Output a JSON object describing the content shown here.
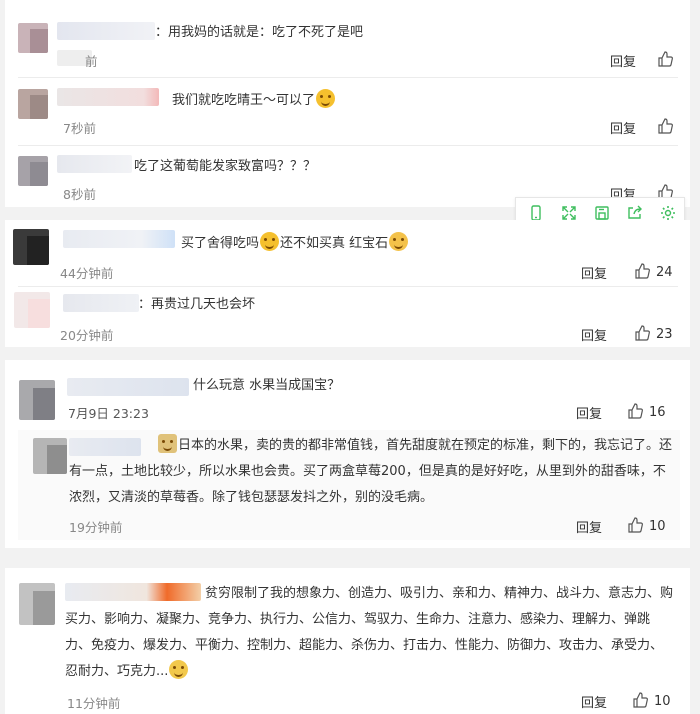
{
  "colors": {
    "accent": "#3fbe5e",
    "text": "#333333",
    "muted": "#888888"
  },
  "reply_label": "回复",
  "comments": [
    {
      "id": "c1",
      "text": "用我妈的话就是：吃了不死了是吧",
      "time": "前",
      "like": ""
    },
    {
      "id": "c2",
      "text": "我们就吃吃晴王～可以了",
      "time": "7秒前",
      "like": ""
    },
    {
      "id": "c3",
      "text": "吃了这葡萄能发家致富吗？？？",
      "time": "8秒前",
      "like": ""
    },
    {
      "id": "c4",
      "text_a": "买了舍得吃吗",
      "text_b": "还不如买真 红宝石",
      "time": "44分钟前",
      "like": "24"
    },
    {
      "id": "c5",
      "text": "再贵过几天也会坏",
      "time": "20分钟前",
      "like": "23"
    },
    {
      "id": "c6",
      "text": "什么玩意 水果当成国宝？",
      "time": "7月9日 23:23",
      "like": "16"
    },
    {
      "id": "c7",
      "text": "日本的水果，卖的贵的都非常值钱，首先甜度就在预定的标准，剩下的，我忘记了。还有一点，土地比较少，所以水果也会贵。买了两盒草莓200，但是真的是好好吃，从里到外的甜香味，不浓烈，又清淡的草莓香。除了钱包瑟瑟发抖之外，别的没毛病。",
      "time": "19分钟前",
      "like": "10"
    },
    {
      "id": "c8",
      "text": "贫穷限制了我的想象力、创造力、吸引力、亲和力、精神力、战斗力、意志力、购买力、影响力、凝聚力、竞争力、执行力、公信力、驾驭力、生命力、注意力、感染力、理解力、弹跳力、免疫力、爆发力、平衡力、控制力、超能力、杀伤力、打击力、性能力、防御力、攻击力、承受力、忍耐力、巧克力...",
      "time": "11分钟前",
      "like": "10"
    }
  ],
  "toolbar": {
    "icons": [
      "phone-icon",
      "expand-icon",
      "save-icon",
      "share-icon",
      "settings-icon"
    ]
  }
}
